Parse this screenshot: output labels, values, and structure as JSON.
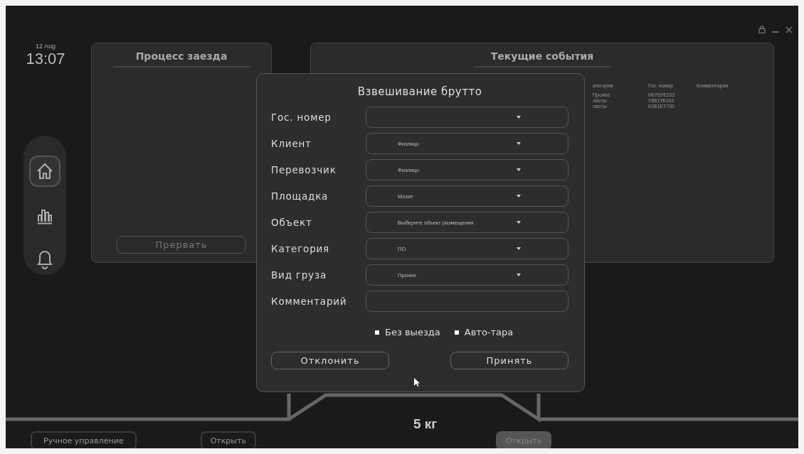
{
  "clock": {
    "date": "12 Aug",
    "time": "13:07"
  },
  "nav": [
    {
      "kind": "home",
      "selected": true
    },
    {
      "kind": "chart",
      "selected": false
    },
    {
      "kind": "bell",
      "selected": false
    }
  ],
  "process_panel": {
    "title": "Процесс заезда",
    "button": "Прервать"
  },
  "events_panel": {
    "title": "Текущие события",
    "columns": [
      "атегория",
      "Гос. номер",
      "Комментарии"
    ],
    "rows": [
      [
        "Прочее",
        "Н070УЕ102",
        ""
      ],
      [
        "ласты",
        "У881УК102",
        ""
      ],
      [
        "ласты",
        "Е061ЕТ702",
        ""
      ]
    ]
  },
  "dialog": {
    "title": "Взвешивание брутто",
    "fields": [
      {
        "label": "Гос. номер",
        "kind": "select"
      },
      {
        "label": "Клиент",
        "kind": "select",
        "value": "Физлицо"
      },
      {
        "label": "Перевозчик",
        "kind": "select",
        "value": "Физлицо"
      },
      {
        "label": "Площадка",
        "kind": "select",
        "value": "Мохит"
      },
      {
        "label": "Объект",
        "kind": "select",
        "value": "Выберите объект размещения"
      },
      {
        "label": "Категория",
        "kind": "select",
        "value": "ПО"
      },
      {
        "label": "Вид груза",
        "kind": "select",
        "value": "Прочее"
      },
      {
        "label": "Комментарий",
        "kind": "text"
      }
    ],
    "checkboxes": [
      {
        "label": "Без выезда",
        "checked": false
      },
      {
        "label": "Авто-тара",
        "checked": false
      }
    ],
    "buttons": [
      "Отклонить",
      "Принять"
    ]
  },
  "scale": {
    "weight": "5 кг"
  },
  "bottom_buttons": [
    {
      "label": "Ручное управление",
      "kind": "outline"
    },
    {
      "label": "Открыть",
      "kind": "outline"
    },
    {
      "label": "Открыть",
      "kind": "filled"
    }
  ]
}
